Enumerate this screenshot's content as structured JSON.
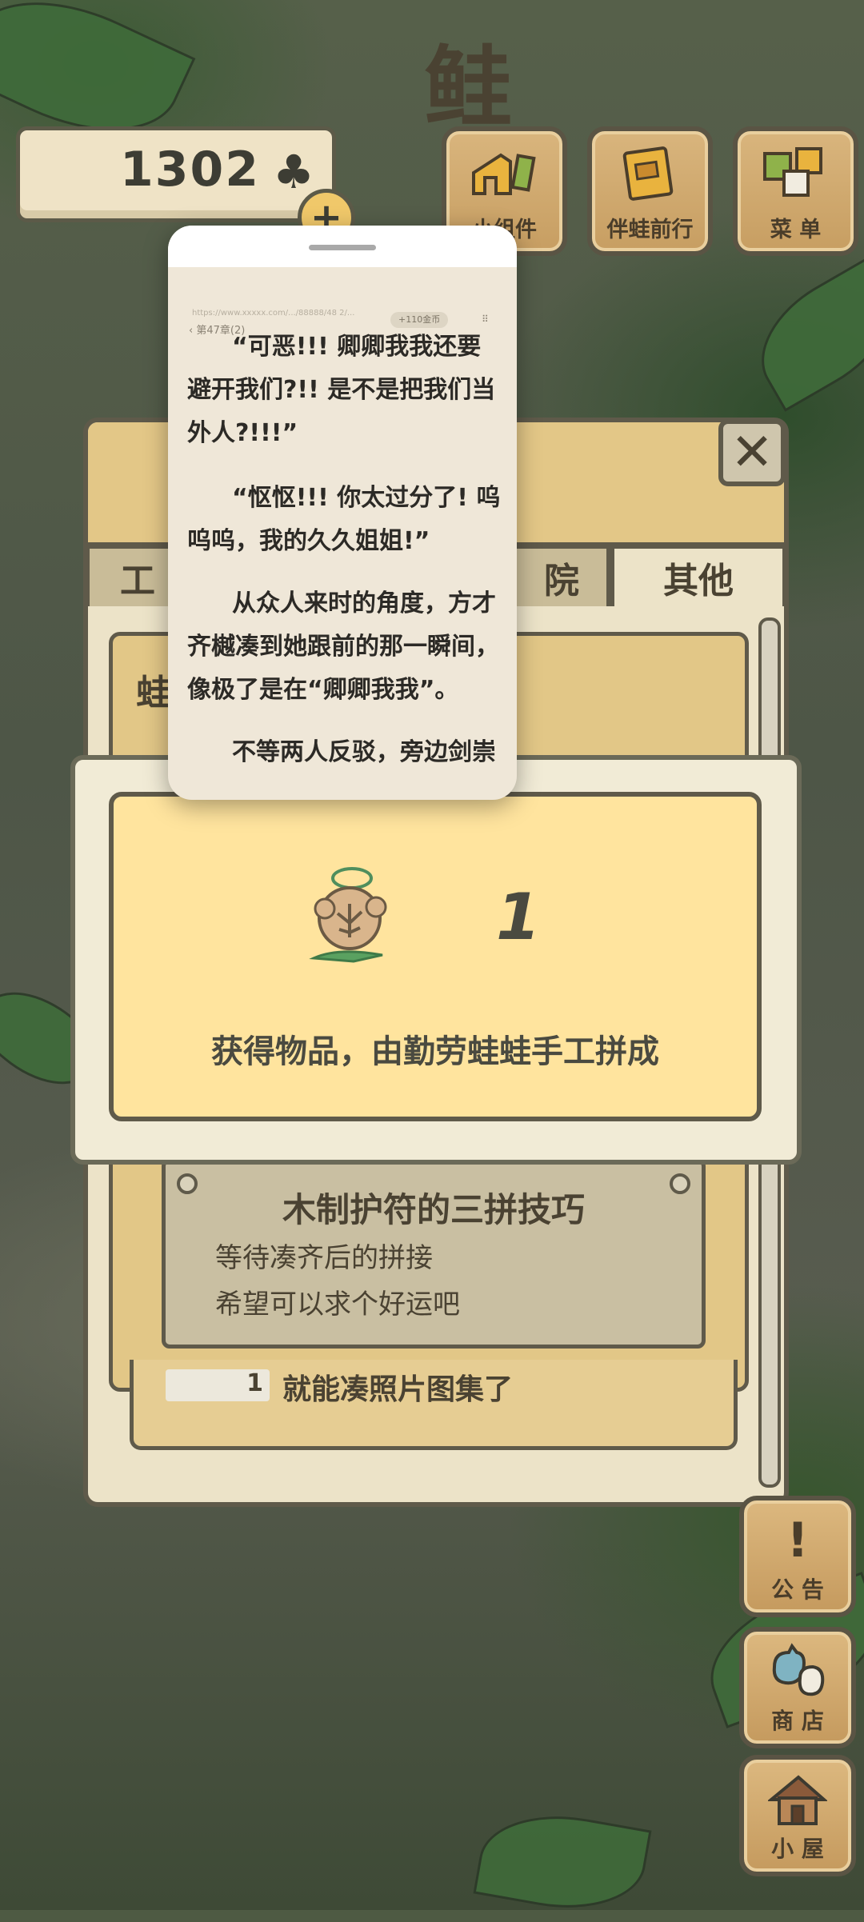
{
  "hud": {
    "coin_value": "1302",
    "coin_icon": "clover-icon",
    "add_label": "+"
  },
  "top_buttons": [
    {
      "label": "小组件",
      "icon": "widget-icon"
    },
    {
      "label": "伴蛙前行",
      "icon": "journey-book-icon"
    },
    {
      "label": "菜 单",
      "icon": "menu-icon"
    }
  ],
  "side_buttons": [
    {
      "label": "公 告",
      "glyph": "!",
      "icon": "notice-icon"
    },
    {
      "label": "商 店",
      "glyph": "",
      "icon": "shop-bag-icon"
    },
    {
      "label": "小 屋",
      "glyph": "",
      "icon": "house-icon"
    }
  ],
  "panel": {
    "title_fragment": "鲑",
    "close_label": "✕",
    "tabs": [
      "工",
      "院",
      "其他"
    ],
    "inner_label": "蛙",
    "card": {
      "title": "木制护符的三拼技巧",
      "lines": [
        "等待凑齐后的拼接",
        "希望可以求个好运吧"
      ]
    },
    "row": {
      "count": "1",
      "text": "就能凑照片图集了"
    }
  },
  "reward": {
    "count": "1",
    "caption": "获得物品，由勤劳蛙蛙手工拼成",
    "item_icon": "wooden-amulet-icon"
  },
  "reader": {
    "url": "https://www.xxxxx.com/.../88888/48 2/...",
    "chapter": "‹ 第47章(2)",
    "coins": "+110金币",
    "menu_icon": "grid-menu-icon",
    "paragraphs": [
      "“可恶!!! 卿卿我我还要避开我们?!! 是不是把我们当外人?!!!”",
      "“怄怄!!! 你太过分了! 呜呜呜，我的久久姐姐!”",
      "从众人来时的角度，方才齐樾凑到她跟前的那一瞬间，像极了是在“卿卿我我”。",
      "不等两人反驳，旁边剑崇"
    ]
  }
}
